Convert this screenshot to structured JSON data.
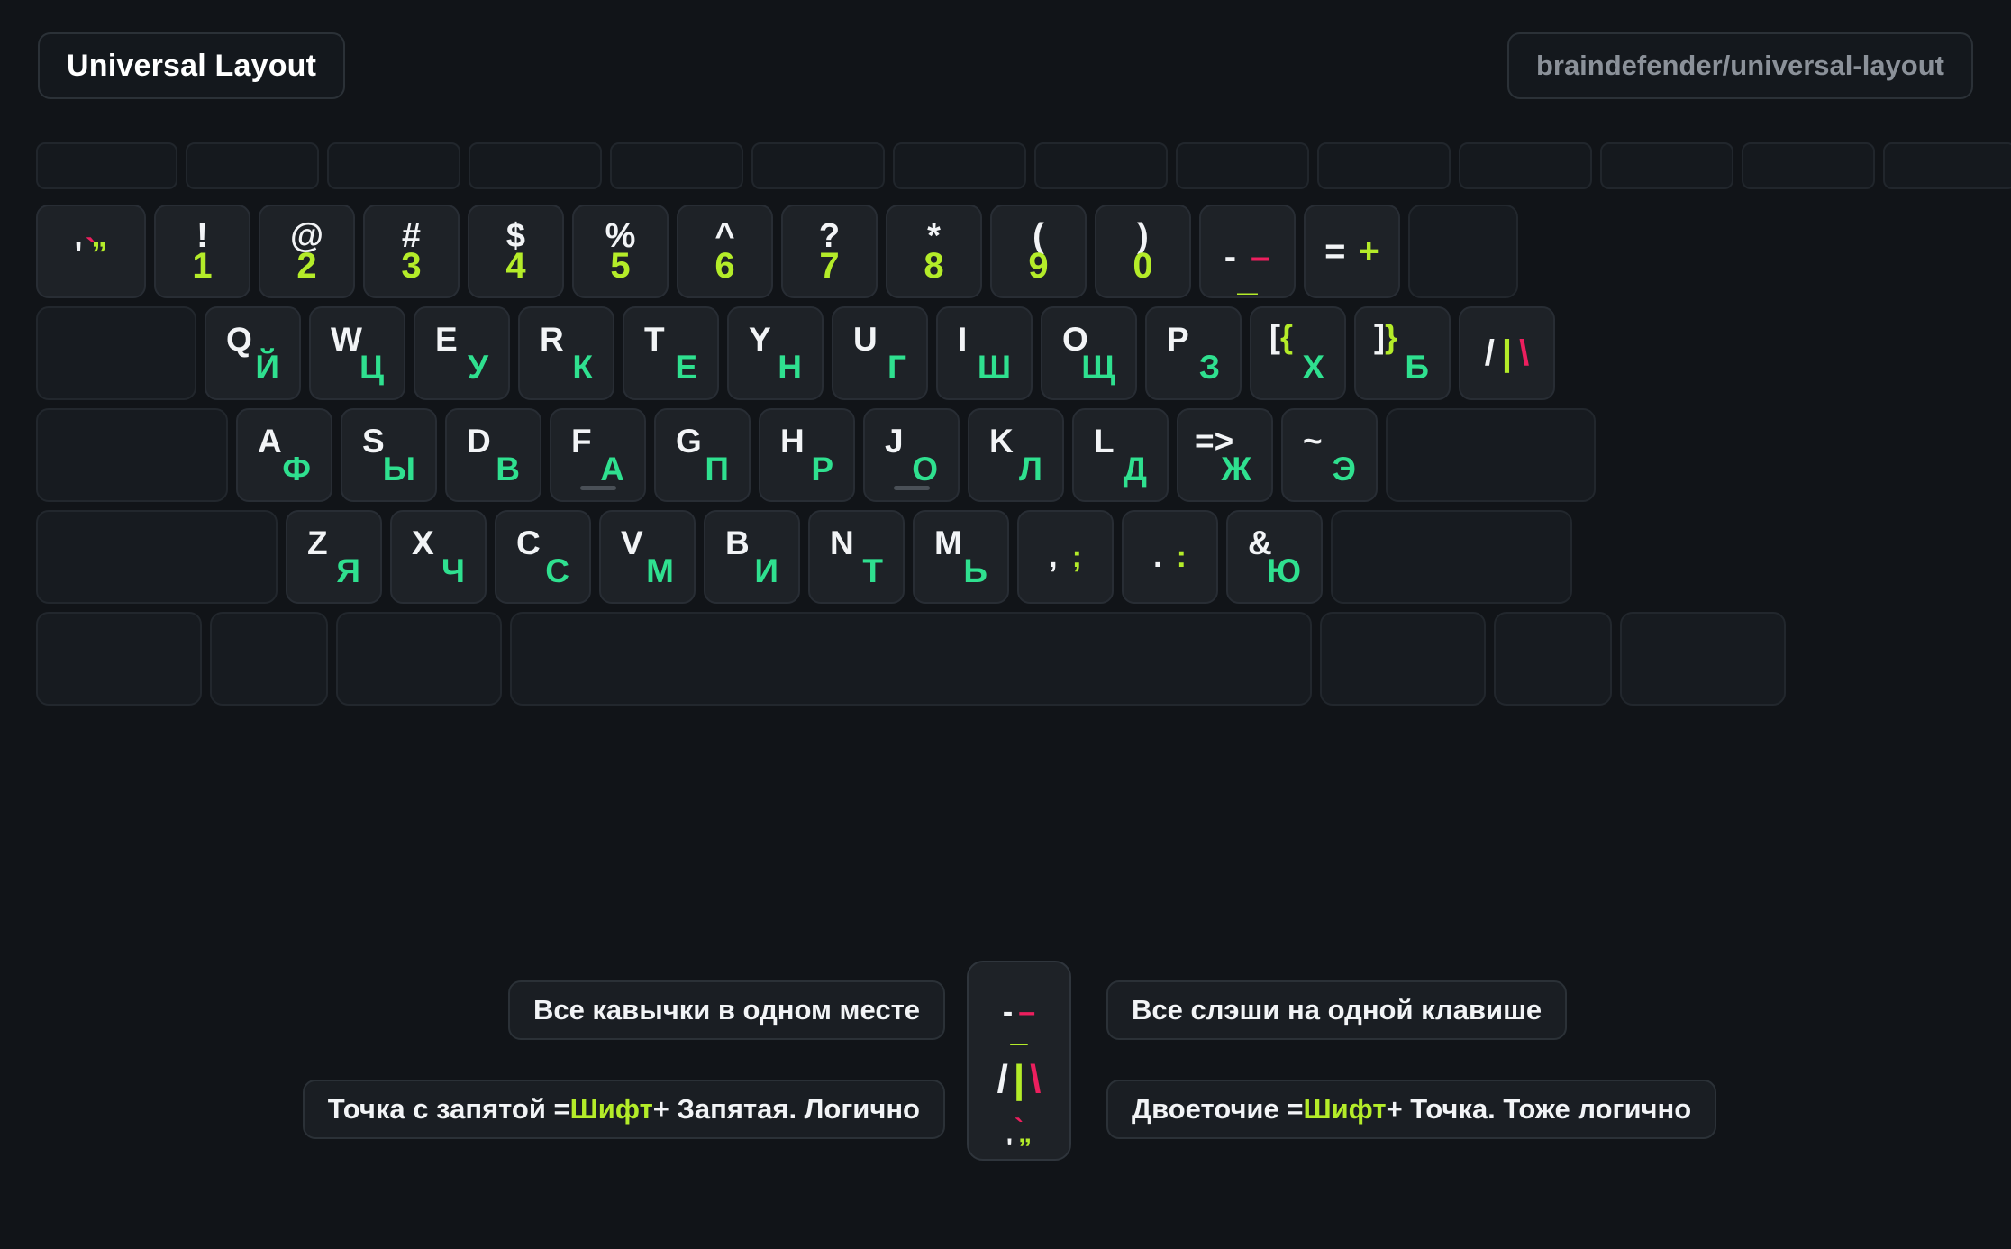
{
  "header": {
    "title": "Universal Layout",
    "repo": "braindefender/universal-layout"
  },
  "colors": {
    "background": "#111418",
    "key_face": "#1e2227",
    "key_border": "#282d34",
    "latin": "#f2f4f6",
    "cyrillic": "#2fe08f",
    "digit_green": "#b4ec29",
    "accent_pink": "#ec1f5e",
    "muted_text": "#8b9199"
  },
  "keyboard": {
    "function_row": {
      "count": 14,
      "keys": [
        "",
        "",
        "",
        "",
        "",
        "",
        "",
        "",
        "",
        "",
        "",
        "",
        "",
        ""
      ]
    },
    "number_row": [
      {
        "name": "backtick",
        "top": "`",
        "bottom_left": "'",
        "bottom_right": "”"
      },
      {
        "name": "1",
        "shift": "!",
        "base": "1"
      },
      {
        "name": "2",
        "shift": "@",
        "base": "2"
      },
      {
        "name": "3",
        "shift": "#",
        "base": "3"
      },
      {
        "name": "4",
        "shift": "$",
        "base": "4"
      },
      {
        "name": "5",
        "shift": "%",
        "base": "5"
      },
      {
        "name": "6",
        "shift": "^",
        "base": "6"
      },
      {
        "name": "7",
        "shift": "?",
        "base": "7"
      },
      {
        "name": "8",
        "shift": "*",
        "base": "8"
      },
      {
        "name": "9",
        "shift": "(",
        "base": "9"
      },
      {
        "name": "0",
        "shift": ")",
        "base": "0"
      },
      {
        "name": "minus",
        "white": "-",
        "pink": "–",
        "green": "_"
      },
      {
        "name": "equal",
        "white": "=",
        "green": "+"
      },
      {
        "name": "backspace",
        "label": ""
      }
    ],
    "top_row": [
      {
        "name": "tab",
        "label": ""
      },
      {
        "name": "q",
        "latin": "Q",
        "cyrillic": "Й"
      },
      {
        "name": "w",
        "latin": "W",
        "cyrillic": "Ц"
      },
      {
        "name": "e",
        "latin": "E",
        "cyrillic": "У"
      },
      {
        "name": "r",
        "latin": "R",
        "cyrillic": "К"
      },
      {
        "name": "t",
        "latin": "T",
        "cyrillic": "Е"
      },
      {
        "name": "y",
        "latin": "Y",
        "cyrillic": "Н"
      },
      {
        "name": "u",
        "latin": "U",
        "cyrillic": "Г"
      },
      {
        "name": "i",
        "latin": "I",
        "cyrillic": "Ш"
      },
      {
        "name": "o",
        "latin": "O",
        "cyrillic": "Щ"
      },
      {
        "name": "p",
        "latin": "P",
        "cyrillic": "З"
      },
      {
        "name": "bracketleft",
        "white": "[",
        "green": "{",
        "cyrillic": "Х"
      },
      {
        "name": "bracketright",
        "white": "]",
        "green": "}",
        "cyrillic": "Б"
      },
      {
        "name": "slash",
        "white": "/",
        "green": "|",
        "pink": "\\"
      }
    ],
    "home_row": [
      {
        "name": "capslock",
        "label": ""
      },
      {
        "name": "a",
        "latin": "A",
        "cyrillic": "Ф"
      },
      {
        "name": "s",
        "latin": "S",
        "cyrillic": "Ы"
      },
      {
        "name": "d",
        "latin": "D",
        "cyrillic": "В"
      },
      {
        "name": "f",
        "latin": "F",
        "cyrillic": "А",
        "bump": true
      },
      {
        "name": "g",
        "latin": "G",
        "cyrillic": "П"
      },
      {
        "name": "h",
        "latin": "H",
        "cyrillic": "Р"
      },
      {
        "name": "j",
        "latin": "J",
        "cyrillic": "О",
        "bump": true
      },
      {
        "name": "k",
        "latin": "K",
        "cyrillic": "Л"
      },
      {
        "name": "l",
        "latin": "L",
        "cyrillic": "Д"
      },
      {
        "name": "semicolon",
        "latin": "=>",
        "cyrillic": "Ж"
      },
      {
        "name": "quote",
        "latin": "~",
        "cyrillic": "Э"
      },
      {
        "name": "enter",
        "label": ""
      }
    ],
    "bottom_row": [
      {
        "name": "shift-left",
        "label": ""
      },
      {
        "name": "z",
        "latin": "Z",
        "cyrillic": "Я"
      },
      {
        "name": "x",
        "latin": "X",
        "cyrillic": "Ч"
      },
      {
        "name": "c",
        "latin": "C",
        "cyrillic": "С"
      },
      {
        "name": "v",
        "latin": "V",
        "cyrillic": "М"
      },
      {
        "name": "b",
        "latin": "B",
        "cyrillic": "И"
      },
      {
        "name": "n",
        "latin": "N",
        "cyrillic": "Т"
      },
      {
        "name": "m",
        "latin": "M",
        "cyrillic": "Ь"
      },
      {
        "name": "comma",
        "white": ",",
        "green": ";"
      },
      {
        "name": "period",
        "white": ".",
        "green": ":"
      },
      {
        "name": "seven-amp",
        "latin": "&",
        "cyrillic": "Ю"
      },
      {
        "name": "shift-right",
        "label": ""
      }
    ],
    "modifier_row": [
      {
        "name": "control",
        "label": ""
      },
      {
        "name": "option",
        "label": ""
      },
      {
        "name": "command-left",
        "label": ""
      },
      {
        "name": "space",
        "label": ""
      },
      {
        "name": "command-right",
        "label": ""
      },
      {
        "name": "option-right",
        "label": ""
      },
      {
        "name": "fn",
        "label": ""
      }
    ]
  },
  "captions": {
    "quotes": "Все кавычки в одном месте",
    "slashes": "Все слэши на одной клавише",
    "semicolon_prefix": "Точка с запятой = ",
    "semicolon_key": "Шифт",
    "semicolon_suffix": " + Запятая. Логично",
    "colon_prefix": "Двоеточие = ",
    "colon_key": "Шифт",
    "colon_suffix": " + Точка. Тоже логично"
  },
  "center_key": {
    "name": "combined-symbol-key",
    "dash_white": "-",
    "dash_pink": "–",
    "underscore_green": "_",
    "slash_white": "/",
    "pipe_green": "|",
    "backslash_pink": "\\",
    "backtick_pink": "`",
    "apostrophe_white": "'",
    "quote_green": "”"
  }
}
